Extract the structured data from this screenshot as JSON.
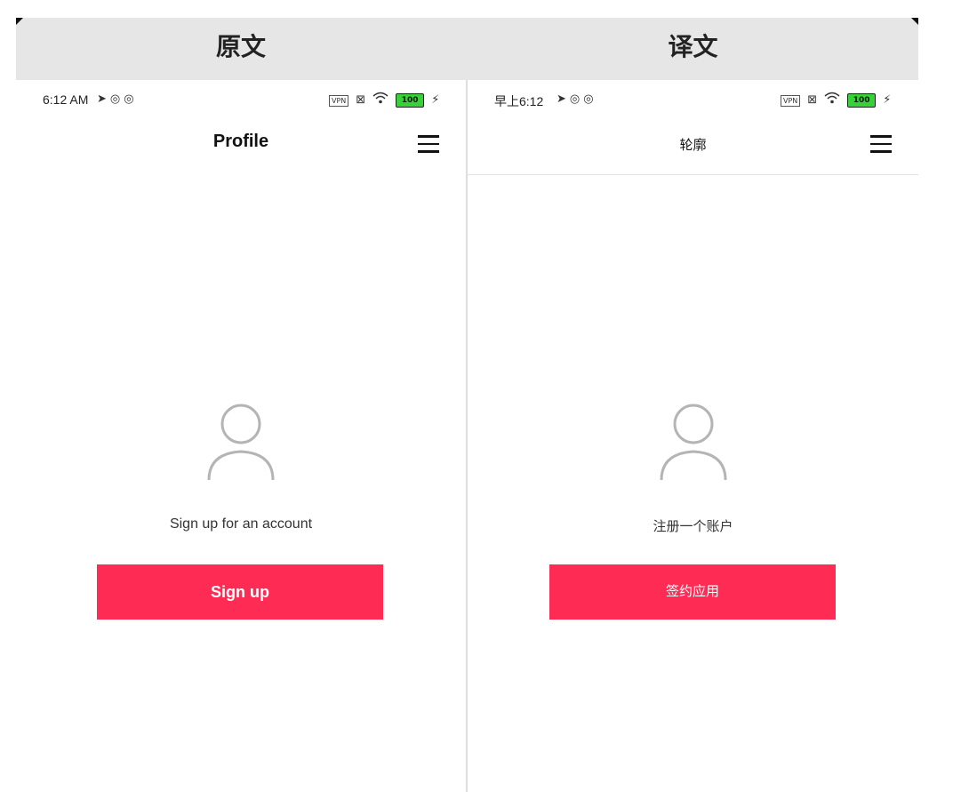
{
  "header": {
    "original_label": "原文",
    "translated_label": "译文"
  },
  "original_screen": {
    "status_bar": {
      "time": "6:12 AM",
      "vpn_label": "VPN",
      "battery": "100"
    },
    "nav": {
      "title": "Profile"
    },
    "body": {
      "prompt": "Sign up for an account",
      "button_label": "Sign up"
    }
  },
  "translated_screen": {
    "status_bar": {
      "time": "早上6:12",
      "vpn_label": "VPN",
      "battery": "100"
    },
    "nav": {
      "title": "轮廓"
    },
    "body": {
      "prompt": "注册一个账户",
      "button_label": "签约应用"
    }
  },
  "colors": {
    "accent": "#fe2c55",
    "header_bg": "#e6e6e6",
    "battery": "#37d237"
  }
}
